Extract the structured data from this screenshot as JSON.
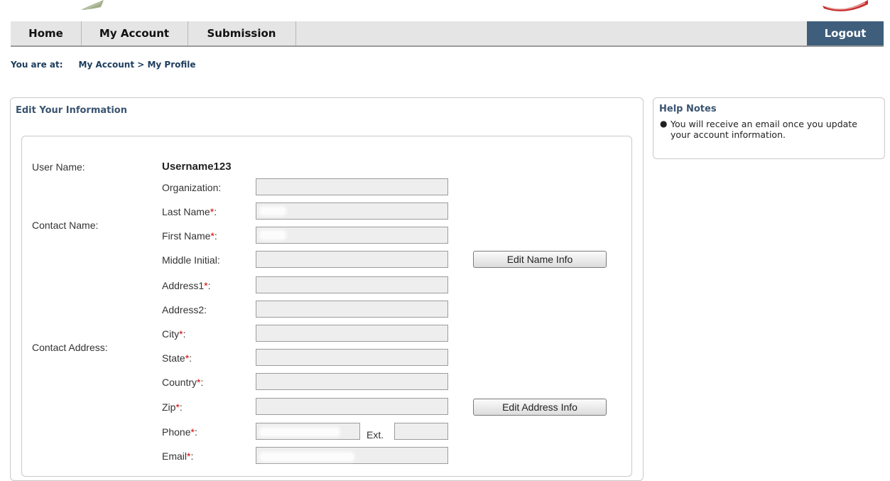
{
  "nav": {
    "home": "Home",
    "my_account": "My Account",
    "submission": "Submission",
    "logout": "Logout"
  },
  "breadcrumb": {
    "prefix": "You are at:",
    "path": "My Account > My Profile"
  },
  "main_panel": {
    "title": "Edit Your Information"
  },
  "help": {
    "title": "Help Notes",
    "notes": [
      "You will receive an email once you update your account information."
    ]
  },
  "form": {
    "user_name_label": "User Name:",
    "user_name_value": "Username123",
    "contact_name_label": "Contact Name:",
    "contact_address_label": "Contact Address:",
    "fields": {
      "organization": "Organization:",
      "last_name": "Last Name",
      "first_name": "First Name",
      "middle_initial": "Middle Initial:",
      "address1": "Address1",
      "address2": "Address2:",
      "city": "City",
      "state": "State",
      "country": "Country",
      "zip": "Zip",
      "phone": "Phone",
      "email": "Email"
    },
    "required_mark": "*",
    "required_suffix": ":",
    "ext_label": "Ext.",
    "edit_name_button": "Edit Name Info",
    "edit_address_button": "Edit Address Info"
  },
  "colors": {
    "nav_bg": "#e5e5e5",
    "logout_bg": "#3f5e7c",
    "breadcrumb": "#1d3d5d",
    "panel_title": "#3a5470",
    "required": "#d40000"
  }
}
